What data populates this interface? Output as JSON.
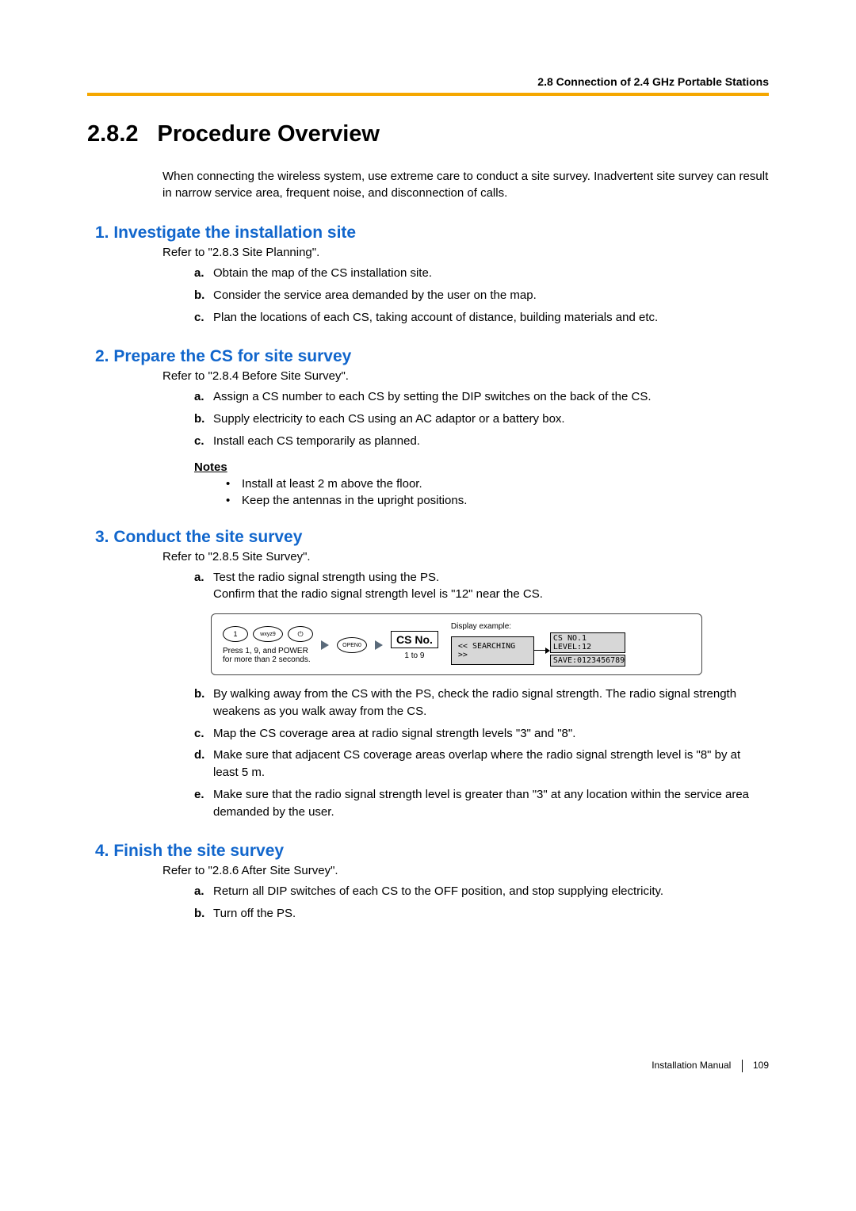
{
  "header": {
    "running": "2.8 Connection of 2.4 GHz Portable Stations"
  },
  "chapter": {
    "number": "2.8.2",
    "title": "Procedure Overview"
  },
  "intro": "When connecting the wireless system, use extreme care to conduct a site survey. Inadvertent site survey can result in narrow service area, frequent noise, and disconnection of calls.",
  "sections": [
    {
      "heading": "1. Investigate the installation site",
      "refer": "Refer to \"2.8.3 Site Planning\".",
      "items": [
        "Obtain the map of the CS installation site.",
        "Consider the service area demanded by the user on the map.",
        "Plan the locations of each CS, taking account of distance, building materials and etc."
      ]
    },
    {
      "heading": "2. Prepare the CS for site survey",
      "refer": "Refer to \"2.8.4 Before Site Survey\".",
      "items": [
        "Assign a CS number to each CS by setting the DIP switches on the back of the CS.",
        "Supply electricity to each CS using an AC adaptor or a battery box.",
        "Install each CS temporarily as planned."
      ],
      "notes_label": "Notes",
      "notes": [
        "Install at least 2 m above the floor.",
        "Keep the antennas in the upright positions."
      ]
    },
    {
      "heading": "3. Conduct the site survey",
      "refer": "Refer to \"2.8.5 Site Survey\".",
      "items_a": [
        "Test the radio signal strength using the PS.",
        "Confirm that the radio signal strength level is \"12\" near the CS."
      ],
      "diagram": {
        "key1": "1",
        "key9": "wxyz9",
        "keyPower": "⏻",
        "keyOpen": "OPEN0",
        "csno": "CS No.",
        "csno_sub": "1 to 9",
        "press_hint": "Press 1, 9, and POWER\nfor more than 2 seconds.",
        "disp_label": "Display example:",
        "screen_search": "<< SEARCHING >>",
        "screen_line1": "CS NO.1 LEVEL:12",
        "screen_line2": "SAVE:0123456789"
      },
      "items_rest": [
        "By walking away from the CS with the PS, check the radio signal strength. The radio signal strength weakens as you walk away from the CS.",
        "Map the CS coverage area at radio signal strength levels \"3\" and \"8\".",
        "Make sure that adjacent CS coverage areas overlap where the radio signal strength level is \"8\" by at least 5 m.",
        "Make sure that the radio signal strength level is greater than \"3\" at any location within the service area demanded by the user."
      ]
    },
    {
      "heading": "4. Finish the site survey",
      "refer": "Refer to \"2.8.6 After Site Survey\".",
      "items": [
        "Return all DIP switches of each CS to the OFF position, and stop supplying electricity.",
        "Turn off the PS."
      ]
    }
  ],
  "footer": {
    "manual": "Installation Manual",
    "page": "109"
  }
}
